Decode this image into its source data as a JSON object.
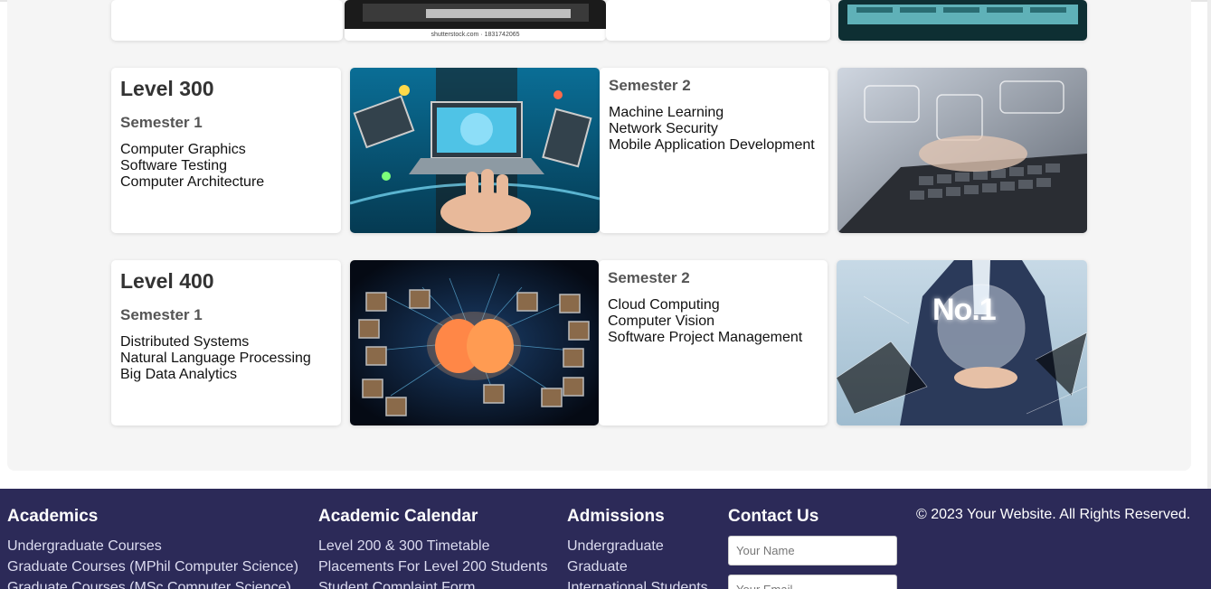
{
  "levels": [
    {
      "level": "Level 300",
      "semester1": {
        "title": "Semester 1",
        "courses": [
          "Computer Graphics",
          "Software Testing",
          "Computer Architecture"
        ]
      },
      "semester2": {
        "title": "Semester 2",
        "courses": [
          "Machine Learning",
          "Network Security",
          "Mobile Application Development"
        ]
      }
    },
    {
      "level": "Level 400",
      "semester1": {
        "title": "Semester 1",
        "courses": [
          "Distributed Systems",
          "Natural Language Processing",
          "Big Data Analytics"
        ]
      },
      "semester2": {
        "title": "Semester 2",
        "courses": [
          "Cloud Computing",
          "Computer Vision",
          "Software Project Management"
        ]
      }
    }
  ],
  "images": {
    "stock_caption": "shutterstock.com · 1831742065",
    "no1_label": "No.1"
  },
  "footer": {
    "academics": {
      "title": "Academics",
      "links": [
        "Undergraduate Courses",
        "Graduate Courses (MPhil Computer Science)",
        "Graduate Courses (MSc Computer Science)"
      ]
    },
    "calendar": {
      "title": "Academic Calendar",
      "links": [
        "Level 200 & 300 Timetable",
        "Placements For Level 200 Students",
        "Student Complaint Form"
      ]
    },
    "admissions": {
      "title": "Admissions",
      "links": [
        "Undergraduate",
        "Graduate",
        "International Students"
      ]
    },
    "contact": {
      "title": "Contact Us",
      "name_placeholder": "Your Name",
      "email_placeholder": "Your Email"
    },
    "copyright": "© 2023 Your Website. All Rights Reserved."
  },
  "colors": {
    "footer_bg": "#2c2a58",
    "panel_bg": "#f5f5f5",
    "card_bg": "#ffffff"
  }
}
